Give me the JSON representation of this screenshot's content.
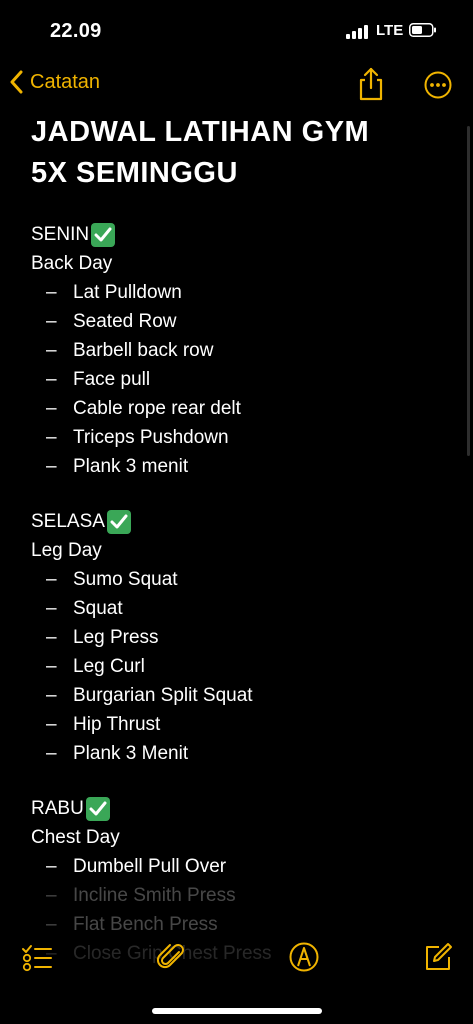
{
  "status": {
    "time": "22.09",
    "network": "LTE"
  },
  "nav": {
    "back_label": "Catatan"
  },
  "note": {
    "title_line1": "JADWAL LATIHAN GYM",
    "title_line2": "5X SEMINGGU",
    "dash": "–",
    "days": [
      {
        "name": "SENIN",
        "subtitle": "Back Day",
        "exercises": [
          "Lat Pulldown",
          "Seated Row",
          "Barbell back row",
          "Face pull",
          "Cable rope rear delt",
          "Triceps Pushdown",
          "Plank 3 menit"
        ]
      },
      {
        "name": "SELASA",
        "subtitle": "Leg Day",
        "exercises": [
          "Sumo Squat",
          "Squat",
          "Leg Press",
          "Leg Curl",
          "Burgarian Split Squat",
          "Hip Thrust",
          "Plank 3 Menit"
        ]
      },
      {
        "name": "RABU",
        "subtitle": "Chest Day",
        "exercises": [
          "Dumbell Pull Over",
          "Incline Smith Press",
          "Flat Bench Press",
          "Close Grip Chest Press"
        ]
      }
    ]
  },
  "colors": {
    "accent": "#f0b400",
    "check": "#3aa757",
    "background": "#000000"
  },
  "icons": [
    "back-chevron-icon",
    "share-icon",
    "more-icon",
    "checklist-icon",
    "attachment-icon",
    "markup-icon",
    "compose-icon",
    "checkmark-icon"
  ]
}
